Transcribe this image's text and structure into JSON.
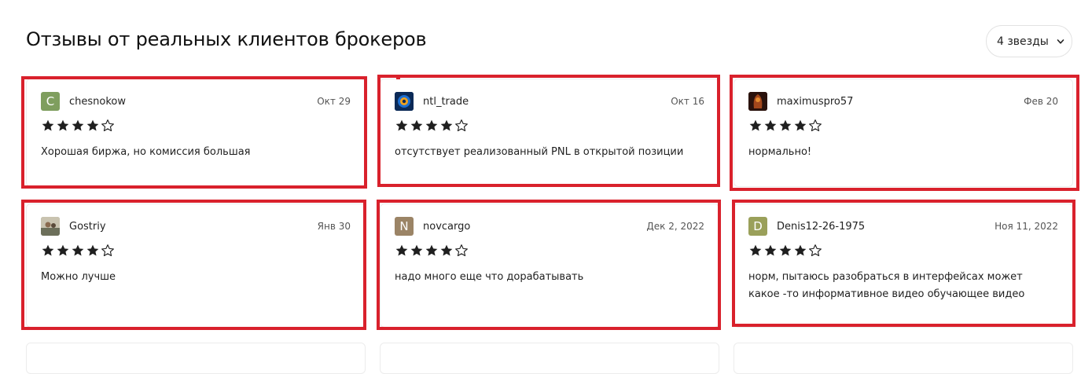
{
  "section": {
    "title": "Отзывы от реальных клиентов брокеров",
    "filter_label": "4 звезды"
  },
  "reviews": [
    {
      "username": "chesnokow",
      "date": "Окт 29",
      "rating": 4,
      "text": "Хорошая биржа, но комиссия большая",
      "avatar_letter": "C",
      "avatar_color": "#7f9e5e"
    },
    {
      "username": "ntl_trade",
      "date": "Окт 16",
      "rating": 4,
      "text": "отсутствует реализованный PNL в открытой позиции",
      "avatar_letter": "",
      "avatar_color": "#0b2a57"
    },
    {
      "username": "maximuspro57",
      "date": "Фев 20",
      "rating": 4,
      "text": "нормально!",
      "avatar_letter": "",
      "avatar_color": "#3a1a12"
    },
    {
      "username": "Gostriy",
      "date": "Янв 30",
      "rating": 4,
      "text": "Можно лучше",
      "avatar_letter": "",
      "avatar_color": "#8a8f7a"
    },
    {
      "username": "novcargo",
      "date": "Дек 2, 2022",
      "rating": 4,
      "text": "надо много еще что дорабатывать",
      "avatar_letter": "N",
      "avatar_color": "#9b8466"
    },
    {
      "username": "Denis12-26-1975",
      "date": "Ноя 11, 2022",
      "rating": 4,
      "text": "норм, пытаюсь разобраться в интерфейсах может какое -то информативное видео обучающее видео",
      "avatar_letter": "D",
      "avatar_color": "#9aa05a"
    }
  ],
  "colors": {
    "highlight": "#d9212c",
    "star": "#1f1f1f"
  }
}
